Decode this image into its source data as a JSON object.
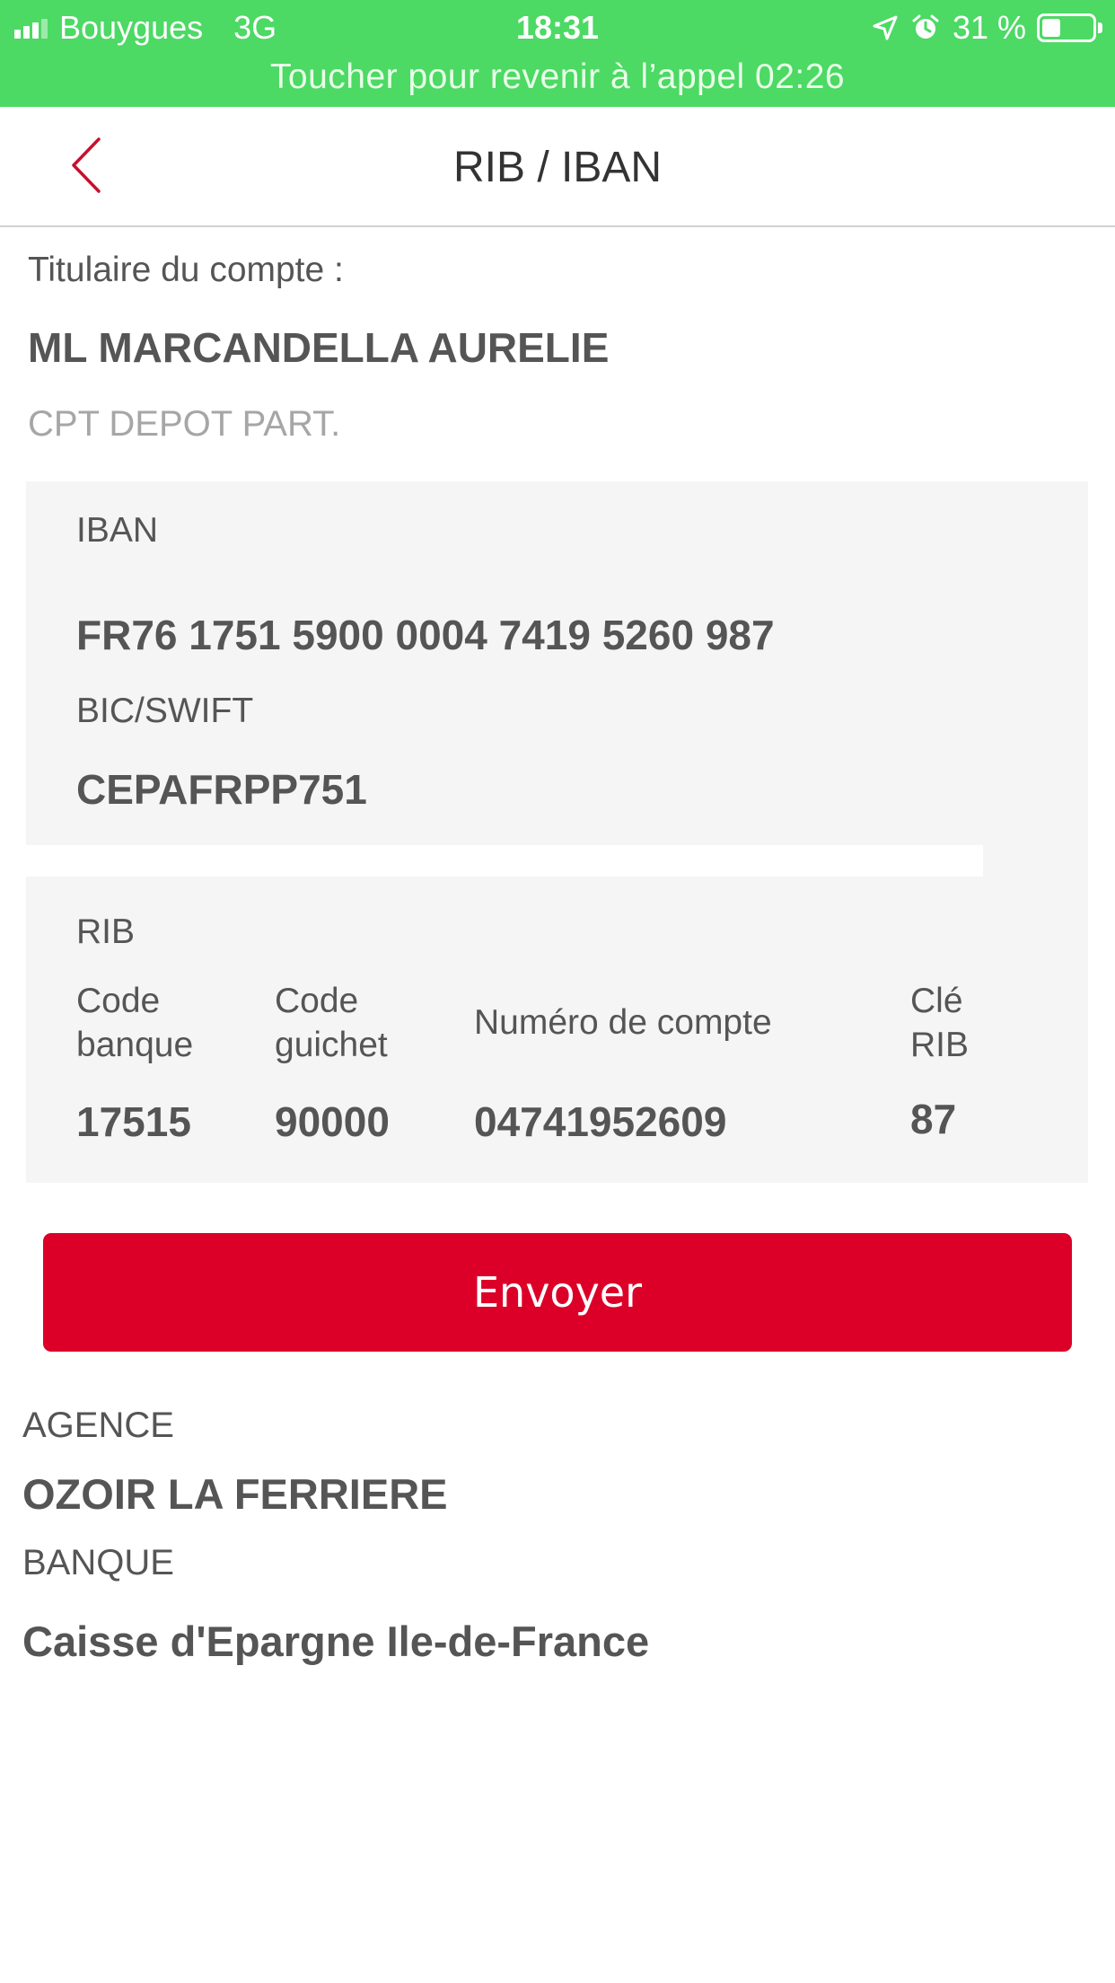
{
  "status_bar": {
    "carrier": "Bouygues",
    "network": "3G",
    "time": "18:31",
    "battery": "31 %",
    "call_banner": "Toucher pour revenir à l’appel 02:26"
  },
  "nav": {
    "title": "RIB / IBAN"
  },
  "account": {
    "holder_label": "Titulaire du compte :",
    "holder_name": "ML MARCANDELLA AURELIE",
    "type": "CPT DEPOT PART."
  },
  "iban_section": {
    "iban_label": "IBAN",
    "iban_value": "FR76 1751 5900 0004 7419 5260 987",
    "bic_label": "BIC/SWIFT",
    "bic_value": "CEPAFRPP751"
  },
  "rib_section": {
    "title": "RIB",
    "columns": [
      {
        "header_line1": "Code",
        "header_line2": "banque",
        "value": "17515"
      },
      {
        "header_line1": "Code",
        "header_line2": "guichet",
        "value": "90000"
      },
      {
        "header_line1": "Numéro de compte",
        "header_line2": "",
        "value": "04741952609"
      },
      {
        "header_line1": "Clé",
        "header_line2": "RIB",
        "value": "87"
      }
    ]
  },
  "actions": {
    "send_label": "Envoyer"
  },
  "agency": {
    "label": "AGENCE",
    "value": "OZOIR LA FERRIERE"
  },
  "bank": {
    "label": "BANQUE",
    "value": "Caisse d'Epargne Ile-de-France"
  },
  "colors": {
    "status_green": "#4cd964",
    "accent_red": "#dc0029",
    "panel_grey": "#f5f5f5"
  }
}
